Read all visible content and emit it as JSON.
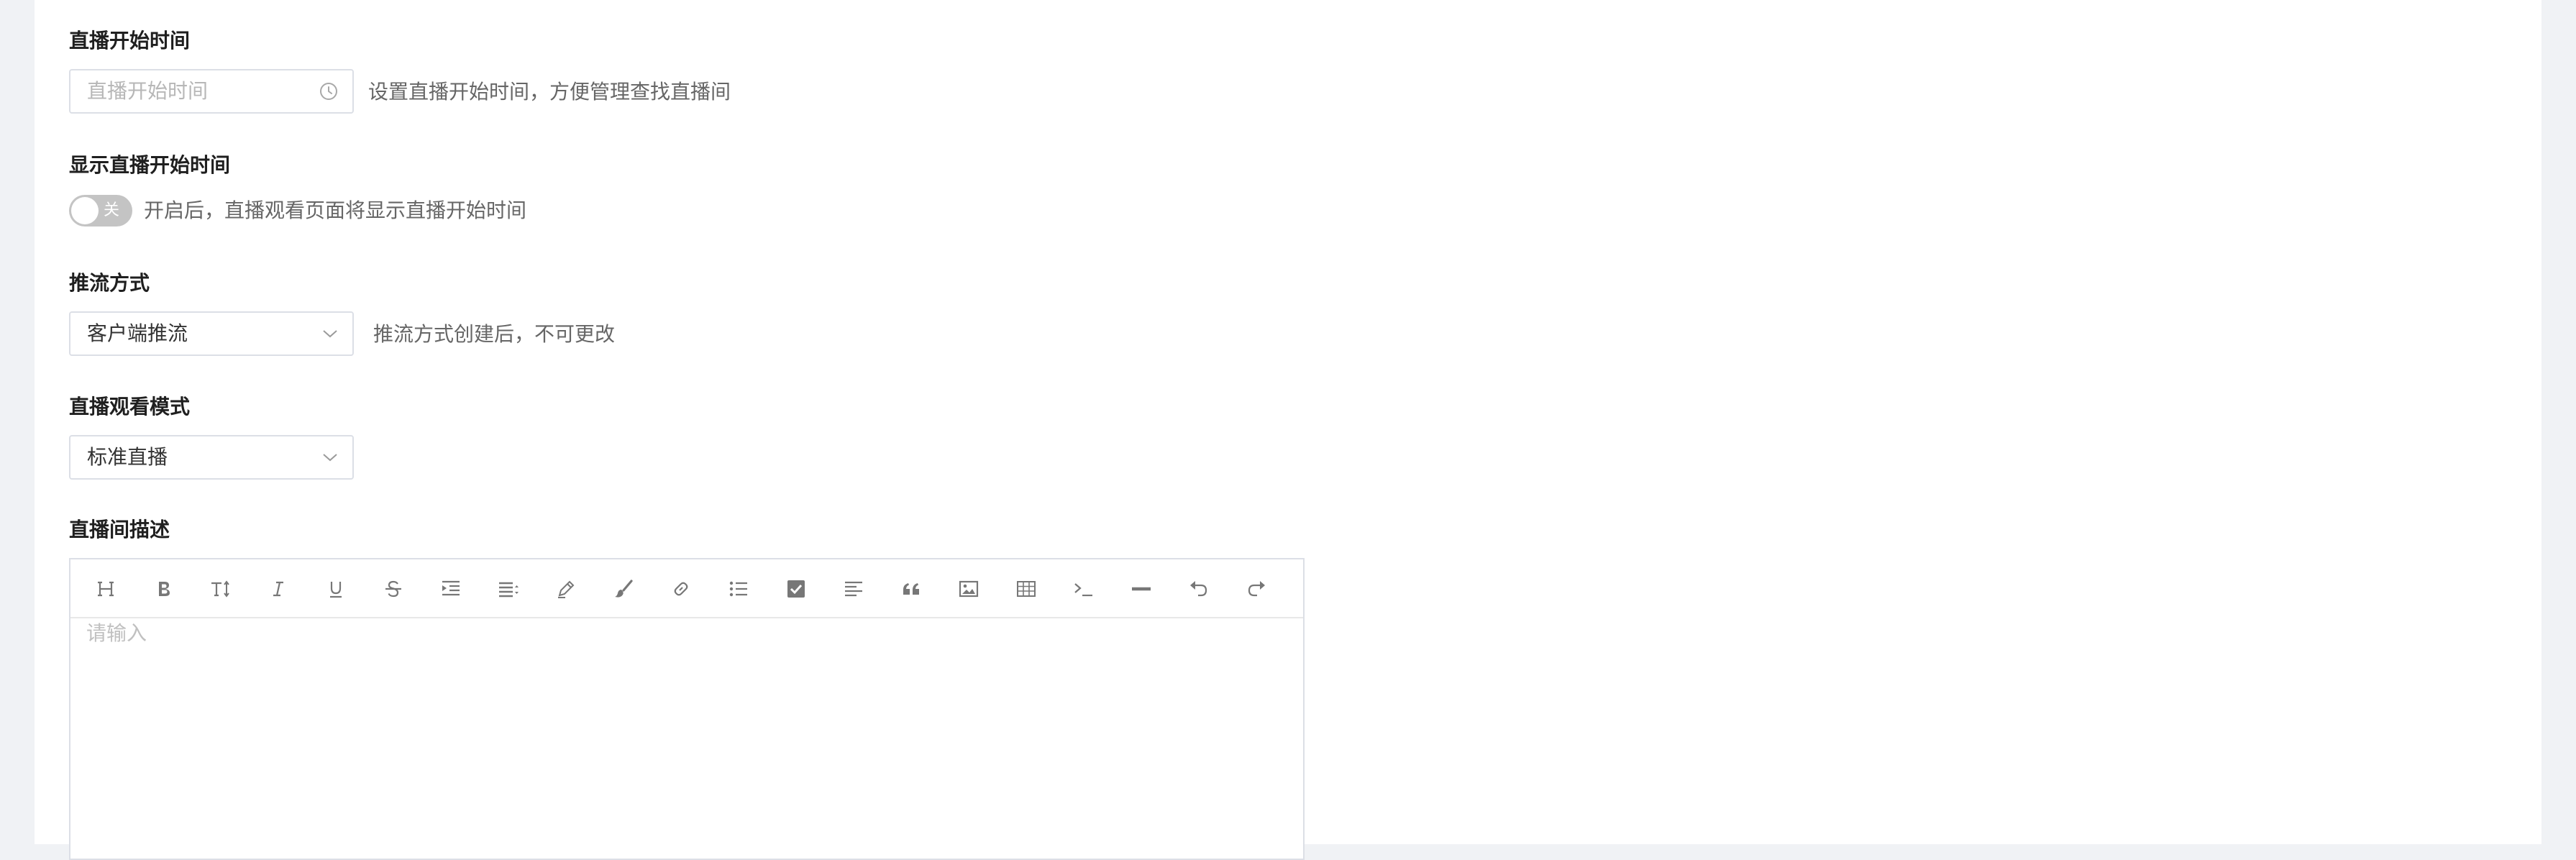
{
  "start_time": {
    "label": "直播开始时间",
    "placeholder": "直播开始时间",
    "hint": "设置直播开始时间，方便管理查找直播间"
  },
  "show_start_time": {
    "label": "显示直播开始时间",
    "toggle_text": "关",
    "toggle_on": false,
    "hint": "开启后，直播观看页面将显示直播开始时间"
  },
  "push_method": {
    "label": "推流方式",
    "value": "客户端推流",
    "hint": "推流方式创建后，不可更改"
  },
  "watch_mode": {
    "label": "直播观看模式",
    "value": "标准直播"
  },
  "description": {
    "label": "直播间描述",
    "placeholder": "请输入",
    "toolbar": [
      "heading-icon",
      "bold-icon",
      "font-size-icon",
      "italic-icon",
      "underline-icon",
      "strikethrough-icon",
      "indent-icon",
      "line-height-icon",
      "pencil-icon",
      "brush-icon",
      "link-icon",
      "list-icon",
      "checkbox-icon",
      "align-icon",
      "quote-icon",
      "image-icon",
      "table-icon",
      "code-icon",
      "divider-icon",
      "undo-icon",
      "redo-icon"
    ]
  }
}
